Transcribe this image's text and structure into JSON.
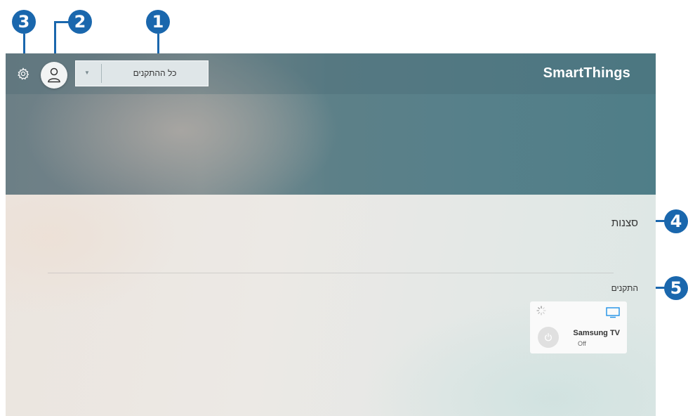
{
  "app": {
    "brand": "SmartThings"
  },
  "header": {
    "location_dropdown": {
      "selected": "כל ההתקנים"
    }
  },
  "sections": {
    "scenes_title": "סצנות",
    "devices_title": "התקנים"
  },
  "devices": [
    {
      "name": "Samsung TV",
      "status": "Off",
      "icon": "tv-icon"
    }
  ],
  "callouts": [
    "1",
    "2",
    "3",
    "4",
    "5"
  ],
  "colors": {
    "callout": "#1a67ad",
    "hero_teal": "#57808a",
    "tv_icon_blue": "#1e90e6"
  }
}
